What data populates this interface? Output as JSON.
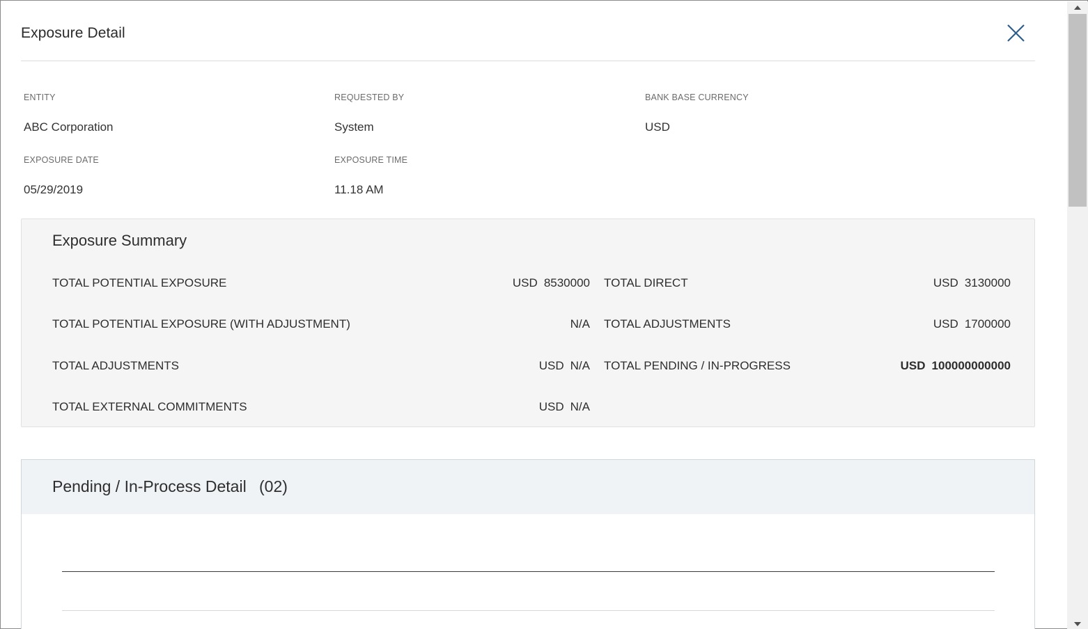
{
  "modal": {
    "title": "Exposure Detail"
  },
  "info": {
    "entity_label": "ENTITY",
    "entity_value": "ABC Corporation",
    "requested_by_label": "REQUESTED BY",
    "requested_by_value": "System",
    "bank_base_currency_label": "BANK BASE CURRENCY",
    "bank_base_currency_value": "USD",
    "exposure_date_label": "EXPOSURE DATE",
    "exposure_date_value": "05/29/2019",
    "exposure_time_label": "EXPOSURE TIME",
    "exposure_time_value": "11.18 AM"
  },
  "summary": {
    "title": "Exposure Summary",
    "left_rows": [
      {
        "label": "TOTAL POTENTIAL EXPOSURE",
        "currency": "USD",
        "value": "8530000"
      },
      {
        "label": "TOTAL POTENTIAL EXPOSURE (WITH ADJUSTMENT)",
        "currency": "",
        "value": "N/A"
      },
      {
        "label": "TOTAL ADJUSTMENTS",
        "currency": "USD",
        "value": "N/A"
      },
      {
        "label": "TOTAL EXTERNAL COMMITMENTS",
        "currency": "USD",
        "value": "N/A"
      }
    ],
    "right_rows": [
      {
        "label": "TOTAL DIRECT",
        "currency": "USD",
        "value": "3130000"
      },
      {
        "label": "TOTAL ADJUSTMENTS",
        "currency": "USD",
        "value": "1700000"
      },
      {
        "label": "TOTAL PENDING / IN-PROGRESS",
        "currency": "USD",
        "value": "100000000000"
      }
    ]
  },
  "pending": {
    "title": "Pending / In-Process Detail",
    "count": "(02)"
  },
  "colors": {
    "close_icon": "#2e5f8a",
    "summary_bg": "#f5f5f5",
    "pending_header_bg": "#eff3f6"
  }
}
